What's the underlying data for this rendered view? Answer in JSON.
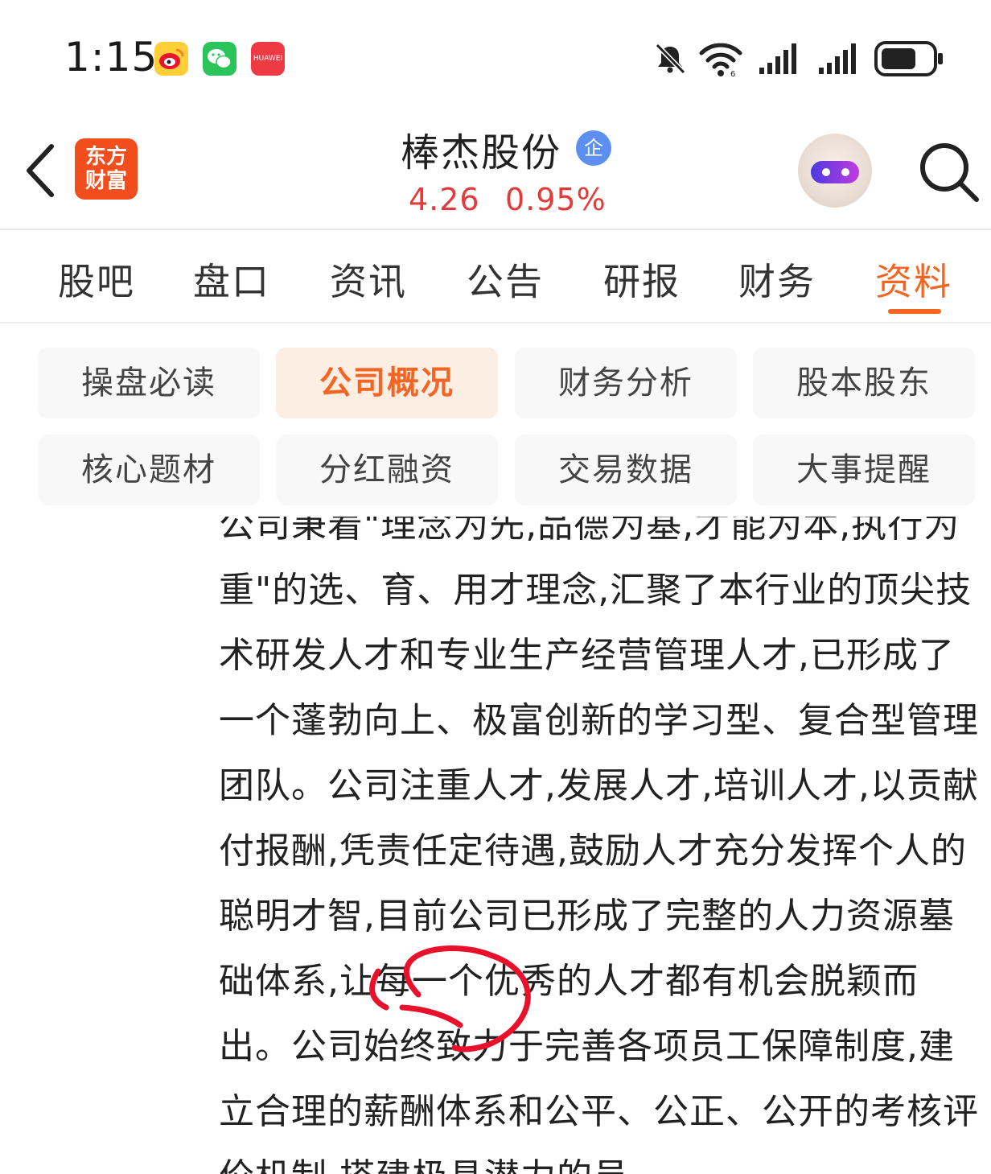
{
  "status_bar": {
    "time": "1:15",
    "notification_apps": [
      "weibo-icon",
      "wechat-icon",
      "huawei-appgallery-icon"
    ],
    "huawei_label": "HUAWEI",
    "icons": [
      "bell-muted-icon",
      "wifi-icon",
      "signal-icon",
      "signal-icon",
      "battery-icon"
    ]
  },
  "header": {
    "logo_text": "东方\n财富",
    "stock_name": "棒杰股份",
    "badge": "企",
    "price": "4.26",
    "change_pct": "0.95%",
    "price_color": "#e33a3a"
  },
  "tabs": {
    "items": [
      "股吧",
      "盘口",
      "资讯",
      "公告",
      "研报",
      "财务",
      "资料"
    ],
    "active_index": 6,
    "accent": "#f26522"
  },
  "sub_menu": {
    "items": [
      "操盘必读",
      "公司概况",
      "财务分析",
      "股本股东",
      "核心题材",
      "分红融资",
      "交易数据",
      "大事提醒"
    ],
    "active_index": 1
  },
  "content": {
    "text": "公司秉着\"理念为先,品德为基,才能为本,执行为重\"的选、育、用才理念,汇聚了本行业的顶尖技术研发人才和专业生产经营管理人才,已形成了一个蓬勃向上、极富创新的学习型、复合型管理团队。公司注重人才,发展人才,培训人才,以贡献付报酬,凭责任定待遇,鼓励人才充分发挥个人的聪明才智,目前公司已形成了完整的人力资源墓础体系,让每一个优秀的人才都有机会脱颖而出。公司始终致力于完善各项员工保障制度,建立合理的薪酬体系和公平、公正、公开的考核评价机制,搭建极具潜力的员"
  }
}
